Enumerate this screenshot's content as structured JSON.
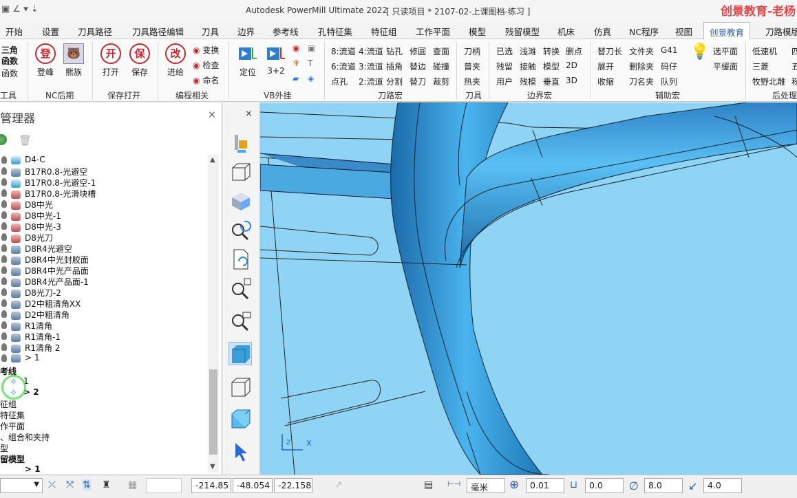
{
  "window": {
    "quick_access": "▣ ∠ ▾ ⇣",
    "app_title": "Autodesk PowerMill Ultimate 2022",
    "project_title": "[ 只读项目 * 2107-02-上课图档-练习 ]",
    "watermark": "创景教育-老杨"
  },
  "menu": {
    "tabs": [
      "开始",
      "设置",
      "刀具路径",
      "刀具路径编辑",
      "刀具",
      "边界",
      "参考线",
      "孔特征集",
      "特征组",
      "工作平面",
      "模型",
      "残留模型",
      "机床",
      "仿真",
      "NC程序",
      "视图",
      "创景教育",
      "刀路模版"
    ],
    "active": "创景教育"
  },
  "ribbon": {
    "col0": [
      "三角",
      "函数",
      "函数"
    ],
    "nc": {
      "b1": "登峰",
      "b2": "熊族",
      "b1_glyph": "登",
      "b2_glyph": "🐻"
    },
    "save": {
      "b1": "打开",
      "b2": "保存",
      "b1_glyph": "开",
      "b2_glyph": "保"
    },
    "edit": {
      "b1": "进给",
      "b1_glyph": "改",
      "s1": "变换",
      "s2": "检查",
      "s3": "命名"
    },
    "vb": {
      "b1": "定位",
      "b2": "3+2"
    },
    "tp": [
      [
        "8:流道",
        "4:流道",
        "钻孔",
        "修圆",
        "查面"
      ],
      [
        "6:流道",
        "3:流道",
        "插角",
        "替边",
        "碰撞"
      ],
      [
        "点孔",
        "2:流道",
        "分割",
        "替刀",
        "裁剪"
      ]
    ],
    "tool": [
      "刀柄",
      "普夹",
      "热夹"
    ],
    "boundary": [
      [
        "已选",
        "浅滩",
        "转换",
        "删点"
      ],
      [
        "残留",
        "接触",
        "模型",
        "2D"
      ],
      [
        "用户",
        "残模",
        "垂直",
        "3D"
      ]
    ],
    "aux": [
      [
        "替刀长",
        "文件夹",
        "G41"
      ],
      [
        "展开",
        "删除夹",
        "码仔"
      ],
      [
        "收缩",
        "刀名夹",
        "队列"
      ]
    ],
    "plane": [
      "选平面",
      "平缓面"
    ],
    "post": [
      "低速机",
      "三菱",
      "牧野北雕"
    ],
    "post_right": [
      "四",
      "五",
      "程"
    ],
    "groups": {
      "g0": "工具",
      "nc": "NC后期",
      "save": "保存打开",
      "edit": "编程相关",
      "vb": "VB外挂",
      "tp": "刀路宏",
      "tool": "刀具",
      "boundary": "边界宏",
      "aux": "辅助宏",
      "post": "后处理"
    }
  },
  "panel": {
    "title": "管理器",
    "close": "×"
  },
  "tree": [
    {
      "label": "D4-C",
      "icon": "cyan"
    },
    {
      "label": "B17R0.8-光避空",
      "icon": "blue"
    },
    {
      "label": "B17R0.8-光避空-1",
      "icon": "outline"
    },
    {
      "label": "B17R0.8-光滑块槽",
      "icon": "red"
    },
    {
      "label": "D8中光",
      "icon": "red"
    },
    {
      "label": "D8中光-1",
      "icon": "red"
    },
    {
      "label": "D8中光-3",
      "icon": "red"
    },
    {
      "label": "D8光刀",
      "icon": "red"
    },
    {
      "label": "D8R4光避空",
      "icon": "blue"
    },
    {
      "label": "D8R4中光封胶面",
      "icon": "blue"
    },
    {
      "label": "D8R4中光产品面",
      "icon": "blue"
    },
    {
      "label": "D8R4光产品面-1",
      "icon": "blue"
    },
    {
      "label": "D8光刀-2",
      "icon": "blue"
    },
    {
      "label": "D2中粗清角XX",
      "icon": "blue"
    },
    {
      "label": "D2中粗清角",
      "icon": "blue"
    },
    {
      "label": "R1清角",
      "icon": "blue"
    },
    {
      "label": "R1清角-1",
      "icon": "blue"
    },
    {
      "label": "R1清角  2",
      "icon": "blue"
    },
    {
      "label": "> 1",
      "icon": "blue"
    }
  ],
  "tree_section": {
    "header": "考线",
    "ref1": "1",
    "ref2": "> 2",
    "items": [
      "征组",
      "特征集",
      "作平面",
      "、组合和夹持",
      "型",
      "留模型",
      "> 1"
    ]
  },
  "viewport": {
    "axis_x": "X",
    "axis_z": "Z"
  },
  "status": {
    "x": "-214.85",
    "y": "-48.054",
    "z": "-22.158",
    "unit": "毫米",
    "tol": "0.01",
    "stock": "0.0",
    "dia": "8.0",
    "rad": "4.0"
  },
  "colors": {
    "model": "#3a9fd8",
    "bg": "#8fd4f5",
    "accent": "#2a5ea8"
  }
}
